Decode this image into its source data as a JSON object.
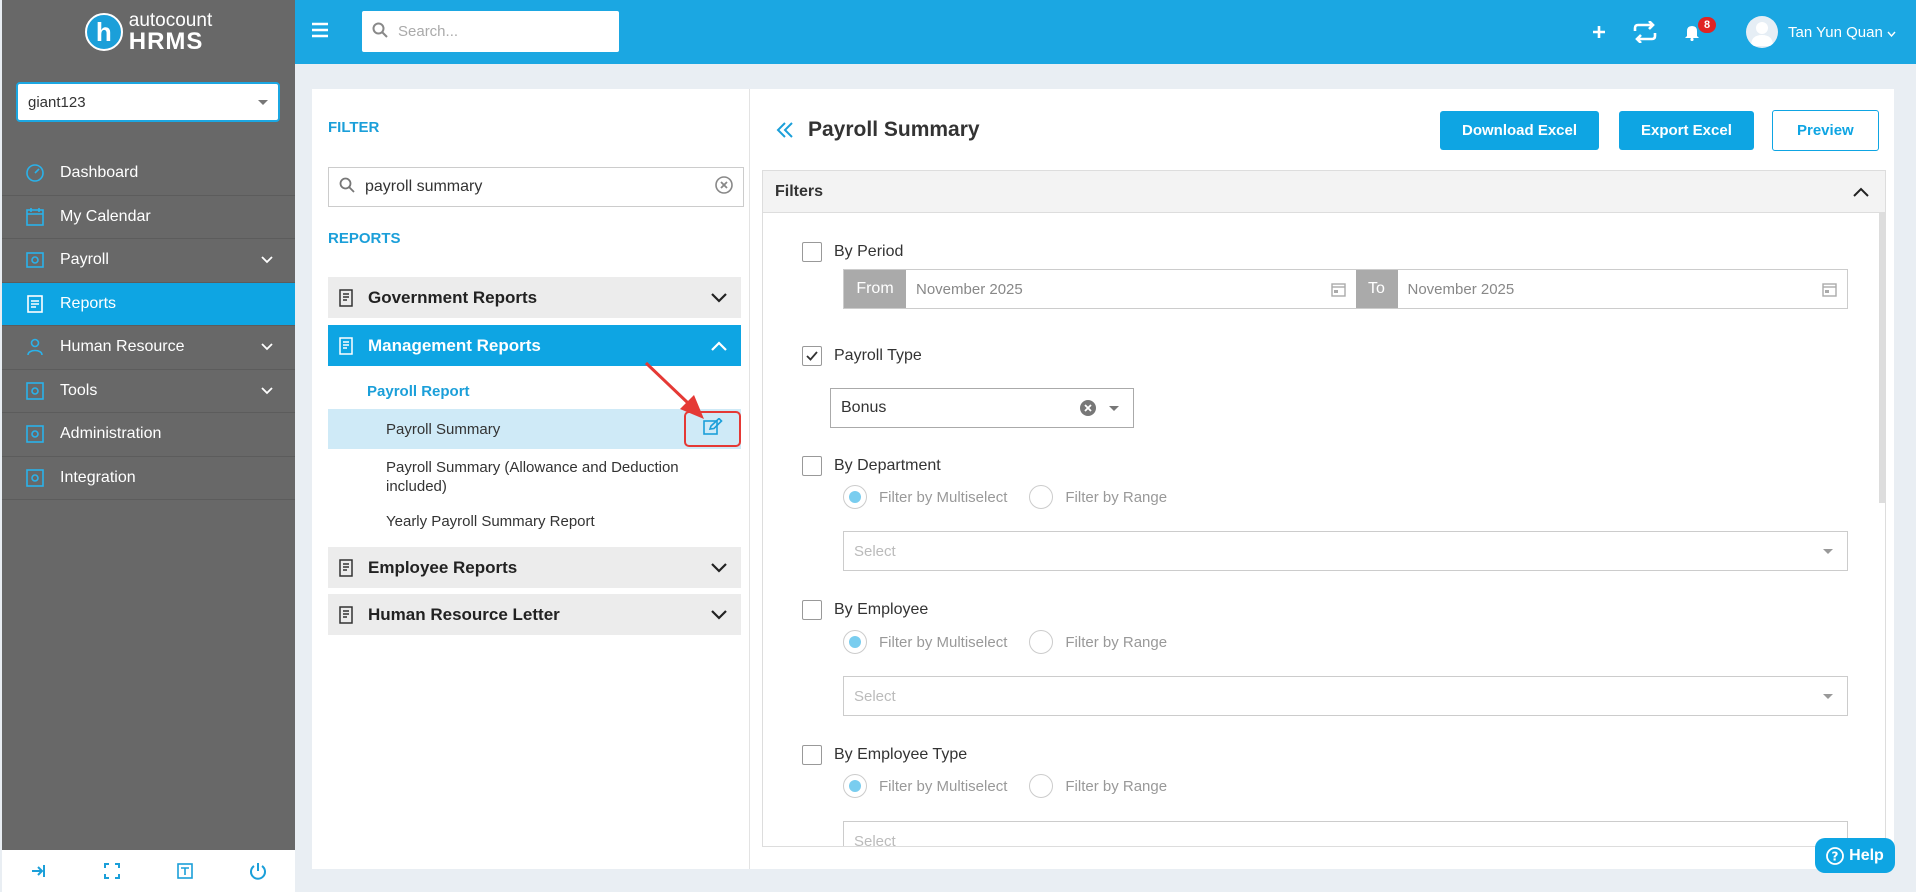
{
  "app": {
    "logo_line1": "autocount",
    "logo_line2": "HRMS",
    "logo_letter": "h"
  },
  "company_select": {
    "value": "giant123"
  },
  "topbar": {
    "search_placeholder": "Search...",
    "notification_count": "8",
    "username": "Tan Yun Quan"
  },
  "sidebar": {
    "items": [
      {
        "label": "Dashboard",
        "icon": "dashboard-icon",
        "active": false,
        "has_children": false
      },
      {
        "label": "My Calendar",
        "icon": "calendar-icon",
        "active": false,
        "has_children": false
      },
      {
        "label": "Payroll",
        "icon": "payroll-icon",
        "active": false,
        "has_children": true
      },
      {
        "label": "Reports",
        "icon": "reports-icon",
        "active": true,
        "has_children": false
      },
      {
        "label": "Human Resource",
        "icon": "human-resource-icon",
        "active": false,
        "has_children": true
      },
      {
        "label": "Tools",
        "icon": "tools-icon",
        "active": false,
        "has_children": true
      },
      {
        "label": "Administration",
        "icon": "administration-icon",
        "active": false,
        "has_children": false
      },
      {
        "label": "Integration",
        "icon": "integration-icon",
        "active": false,
        "has_children": false
      }
    ],
    "bottom_icons": [
      "logout-icon",
      "fullscreen-icon",
      "language-icon",
      "power-icon"
    ]
  },
  "left_panel": {
    "filter_label": "FILTER",
    "filter_value": "payroll summary",
    "reports_label": "REPORTS",
    "accordions": [
      {
        "label": "Government Reports",
        "open": false
      },
      {
        "label": "Management Reports",
        "open": true
      },
      {
        "label": "Employee Reports",
        "open": false
      },
      {
        "label": "Human Resource Letter",
        "open": false
      }
    ],
    "sub_header": "Payroll Report",
    "report_items": [
      {
        "label": "Payroll Summary",
        "selected": true
      },
      {
        "label": "Payroll Summary (Allowance and Deduction included)",
        "selected": false
      },
      {
        "label": "Yearly Payroll Summary Report",
        "selected": false
      }
    ]
  },
  "right_panel": {
    "title": "Payroll Summary",
    "buttons": {
      "download": "Download Excel",
      "export": "Export Excel",
      "preview": "Preview"
    },
    "filters_title": "Filters",
    "by_period": {
      "label": "By Period",
      "checked": false,
      "from_label": "From",
      "from_value": "November 2025",
      "to_label": "To",
      "to_value": "November 2025"
    },
    "payroll_type": {
      "label": "Payroll Type",
      "checked": true,
      "value": "Bonus"
    },
    "by_department": {
      "label": "By Department",
      "checked": false,
      "radio1": "Filter by Multiselect",
      "radio2": "Filter by Range",
      "select_placeholder": "Select"
    },
    "by_employee": {
      "label": "By Employee",
      "checked": false,
      "radio1": "Filter by Multiselect",
      "radio2": "Filter by Range",
      "select_placeholder": "Select"
    },
    "by_employee_type": {
      "label": "By Employee Type",
      "checked": false,
      "radio1": "Filter by Multiselect",
      "radio2": "Filter by Range",
      "select_placeholder": "Select"
    }
  },
  "help": {
    "label": "Help"
  },
  "colors": {
    "accent": "#1ba7e2",
    "sidebar": "#686868",
    "highlight": "#e53935"
  }
}
